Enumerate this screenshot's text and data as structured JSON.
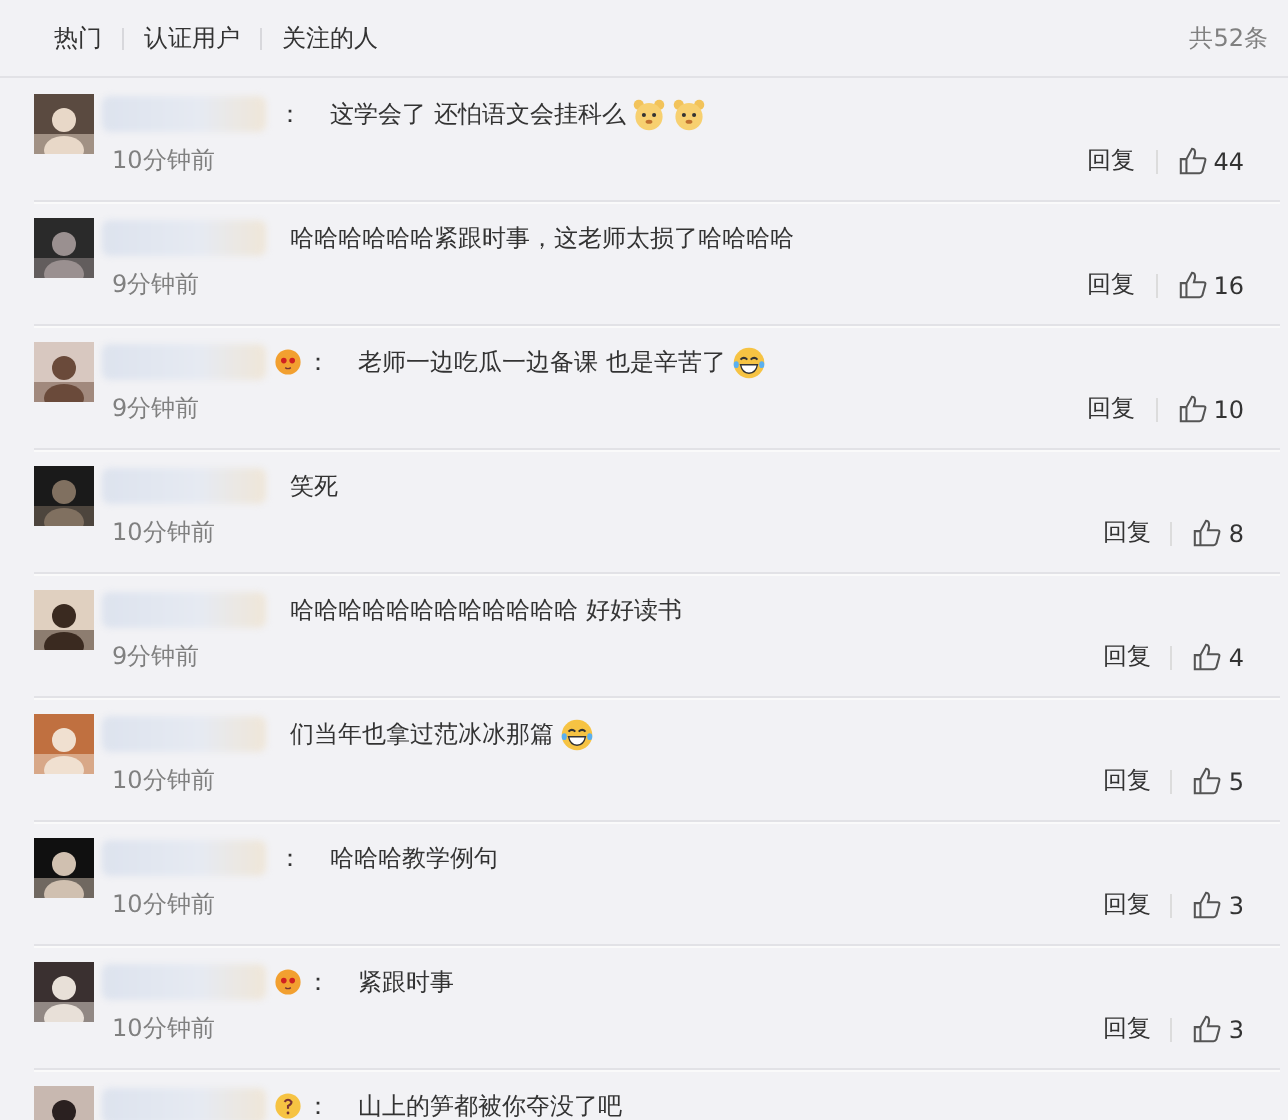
{
  "tabs": [
    {
      "label": "热门"
    },
    {
      "label": "认证用户"
    },
    {
      "label": "关注的人"
    }
  ],
  "total": "共52条",
  "comments": [
    {
      "colon": "：",
      "text": "这学会了 还怕语文会挂科么",
      "trailing_emojis": [
        {
          "kind": "bear"
        },
        {
          "kind": "bear"
        }
      ],
      "time": "10分钟前",
      "reply": "回复",
      "likes": "44"
    },
    {
      "text": "哈哈哈哈哈哈紧跟时事，这老师太损了哈哈哈哈",
      "time": "9分钟前",
      "reply": "回复",
      "likes": "16"
    },
    {
      "name_emoji": {
        "kind": "blush"
      },
      "colon": "：",
      "text": "老师一边吃瓜一边备课 也是辛苦了",
      "trailing_emojis": [
        {
          "kind": "laugh"
        }
      ],
      "time": "9分钟前",
      "reply": "回复",
      "likes": "10"
    },
    {
      "text": "笑死",
      "time": "10分钟前",
      "reply": "回复",
      "likes": "8"
    },
    {
      "text": "哈哈哈哈哈哈哈哈哈哈哈哈 好好读书",
      "time": "9分钟前",
      "reply": "回复",
      "likes": "4"
    },
    {
      "text": "们当年也拿过范冰冰那篇",
      "trailing_emojis": [
        {
          "kind": "laugh"
        }
      ],
      "time": "10分钟前",
      "reply": "回复",
      "likes": "5"
    },
    {
      "colon": "：",
      "text": "哈哈哈教学例句",
      "time": "10分钟前",
      "reply": "回复",
      "likes": "3"
    },
    {
      "name_emoji": {
        "kind": "blush"
      },
      "colon": "：",
      "text": "紧跟时事",
      "time": "10分钟前",
      "reply": "回复",
      "likes": "3"
    },
    {
      "name_emoji": {
        "kind": "puzzled"
      },
      "colon": "：",
      "text": "山上的笋都被你夺没了吧"
    }
  ]
}
